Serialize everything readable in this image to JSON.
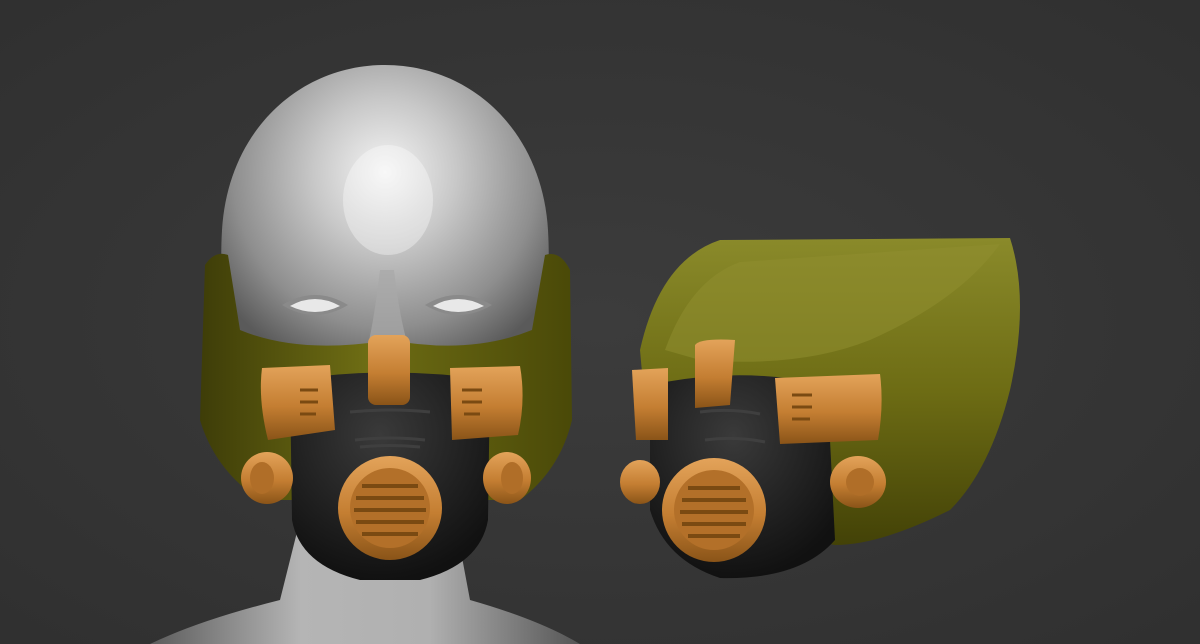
{
  "scene": {
    "background_color": "#373737",
    "colors": {
      "skin": "#b9b9b9",
      "mask_olive": "#6b6a12",
      "mask_black": "#1c1c1c",
      "orange": "#c98436"
    },
    "objects": [
      {
        "kind": "render",
        "icon": "head-with-mask"
      },
      {
        "kind": "render",
        "icon": "mask-three-quarter-view"
      }
    ]
  }
}
